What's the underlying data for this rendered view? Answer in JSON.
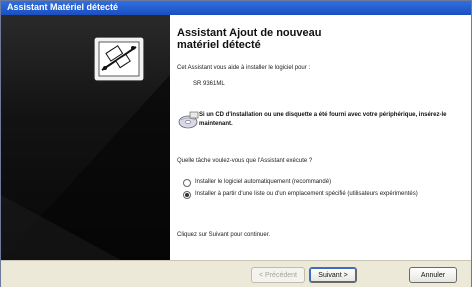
{
  "window": {
    "title": "Assistant Matériel détecté"
  },
  "wizard": {
    "heading_line1": "Assistant Ajout de nouveau",
    "heading_line2": "matériel détecté",
    "intro": "Cet Assistant vous aide à installer le logiciel pour :",
    "device_name": "SR 9361ML",
    "cd_hint": "Si un CD d'installation ou une disquette a été fourni avec votre périphérique, insérez-le maintenant.",
    "question": "Quelle tâche voulez-vous que l'Assistant exécute ?",
    "option_auto": "Installer le logiciel automatiquement (recommandé)",
    "option_manual": "Installer à partir d'une liste ou d'un emplacement spécifié (utilisateurs expérimentés)",
    "selected_option": "manual",
    "next_hint": "Cliquez sur Suivant pour continuer."
  },
  "footer": {
    "prev_label": "< Précédent",
    "next_label": "Suivant >",
    "cancel_label": "Annuler"
  },
  "colors": {
    "titlebar": "#2f6fdf",
    "sidebar": "#111111",
    "footer": "#ece9d8"
  },
  "icons": {
    "wizard_graphic": "hardware-device-icon",
    "cd": "cd-disk-icon"
  }
}
